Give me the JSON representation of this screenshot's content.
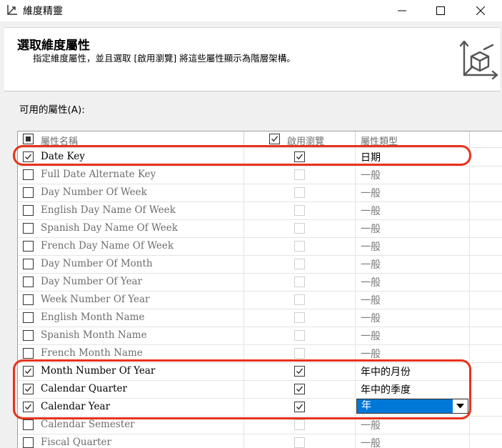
{
  "window": {
    "title": "維度精靈",
    "icon": "wizard-app-icon",
    "controls": [
      "minimize-icon",
      "maximize-icon",
      "close-icon"
    ]
  },
  "header": {
    "title": "選取維度屬性",
    "description": "指定維度屬性，並且選取 [啟用瀏覽] 將這些屬性顯示為階層架構。",
    "icon": "dimension-cube-icon"
  },
  "available_label": "可用的屬性(A):",
  "columns": {
    "name": "屬性名稱",
    "enable_browse": "啟用瀏覽",
    "type": "屬性類型"
  },
  "header_select_all_state": "indeterminate",
  "header_browse_checked": true,
  "rows": [
    {
      "name": "Date Key",
      "checked": true,
      "browse": true,
      "type": "日期"
    },
    {
      "name": "Full Date Alternate Key",
      "checked": false,
      "browse": false,
      "type": "一般"
    },
    {
      "name": "Day Number Of Week",
      "checked": false,
      "browse": false,
      "type": "一般"
    },
    {
      "name": "English Day Name Of Week",
      "checked": false,
      "browse": false,
      "type": "一般"
    },
    {
      "name": "Spanish Day Name Of Week",
      "checked": false,
      "browse": false,
      "type": "一般"
    },
    {
      "name": "French Day Name Of Week",
      "checked": false,
      "browse": false,
      "type": "一般"
    },
    {
      "name": "Day Number Of Month",
      "checked": false,
      "browse": false,
      "type": "一般"
    },
    {
      "name": "Day Number Of Year",
      "checked": false,
      "browse": false,
      "type": "一般"
    },
    {
      "name": "Week Number Of Year",
      "checked": false,
      "browse": false,
      "type": "一般"
    },
    {
      "name": "English Month Name",
      "checked": false,
      "browse": false,
      "type": "一般"
    },
    {
      "name": "Spanish Month Name",
      "checked": false,
      "browse": false,
      "type": "一般"
    },
    {
      "name": "French Month Name",
      "checked": false,
      "browse": false,
      "type": "一般"
    },
    {
      "name": "Month Number Of Year",
      "checked": true,
      "browse": true,
      "type": "年中的月份"
    },
    {
      "name": "Calendar Quarter",
      "checked": true,
      "browse": true,
      "type": "年中的季度"
    },
    {
      "name": "Calendar Year",
      "checked": true,
      "browse": true,
      "type": "年",
      "editing": true
    },
    {
      "name": "Calendar Semester",
      "checked": false,
      "browse": false,
      "type": "一般"
    },
    {
      "name": "Fiscal Quarter",
      "checked": false,
      "browse": false,
      "type": "一般"
    }
  ],
  "colors": {
    "highlight": "#e8321b",
    "selection": "#0078d7"
  }
}
